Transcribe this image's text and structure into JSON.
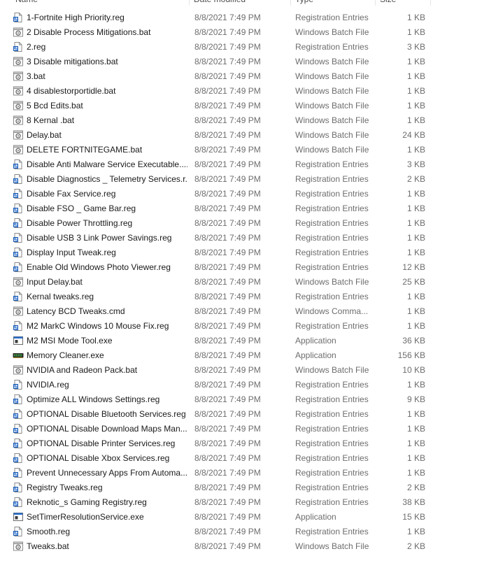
{
  "columns": {
    "name": "Name",
    "date_modified": "Date modified",
    "type": "Type",
    "size": "Size"
  },
  "files": [
    {
      "name": "1-Fortnite High Priority.reg",
      "date": "8/8/2021 7:49 PM",
      "type": "Registration Entries",
      "size": "1 KB",
      "icon": "reg-file-icon"
    },
    {
      "name": "2 Disable Process Mitigations.bat",
      "date": "8/8/2021 7:49 PM",
      "type": "Windows Batch File",
      "size": "1 KB",
      "icon": "bat-file-icon"
    },
    {
      "name": "2.reg",
      "date": "8/8/2021 7:49 PM",
      "type": "Registration Entries",
      "size": "3 KB",
      "icon": "reg-file-icon"
    },
    {
      "name": "3 Disable mitigations.bat",
      "date": "8/8/2021 7:49 PM",
      "type": "Windows Batch File",
      "size": "1 KB",
      "icon": "bat-file-icon"
    },
    {
      "name": "3.bat",
      "date": "8/8/2021 7:49 PM",
      "type": "Windows Batch File",
      "size": "1 KB",
      "icon": "bat-file-icon"
    },
    {
      "name": "4 disablestorportidle.bat",
      "date": "8/8/2021 7:49 PM",
      "type": "Windows Batch File",
      "size": "1 KB",
      "icon": "bat-file-icon"
    },
    {
      "name": "5 Bcd Edits.bat",
      "date": "8/8/2021 7:49 PM",
      "type": "Windows Batch File",
      "size": "1 KB",
      "icon": "bat-file-icon"
    },
    {
      "name": "8 Kernal .bat",
      "date": "8/8/2021 7:49 PM",
      "type": "Windows Batch File",
      "size": "1 KB",
      "icon": "bat-file-icon"
    },
    {
      "name": "Delay.bat",
      "date": "8/8/2021 7:49 PM",
      "type": "Windows Batch File",
      "size": "24 KB",
      "icon": "bat-file-icon"
    },
    {
      "name": "DELETE FORTNITEGAME.bat",
      "date": "8/8/2021 7:49 PM",
      "type": "Windows Batch File",
      "size": "1 KB",
      "icon": "bat-file-icon"
    },
    {
      "name": "Disable Anti Malware Service Executable....",
      "date": "8/8/2021 7:49 PM",
      "type": "Registration Entries",
      "size": "3 KB",
      "icon": "reg-file-icon"
    },
    {
      "name": "Disable Diagnostics _ Telemetry Services.r...",
      "date": "8/8/2021 7:49 PM",
      "type": "Registration Entries",
      "size": "2 KB",
      "icon": "reg-file-icon"
    },
    {
      "name": "Disable Fax Service.reg",
      "date": "8/8/2021 7:49 PM",
      "type": "Registration Entries",
      "size": "1 KB",
      "icon": "reg-file-icon"
    },
    {
      "name": "Disable FSO _ Game Bar.reg",
      "date": "8/8/2021 7:49 PM",
      "type": "Registration Entries",
      "size": "1 KB",
      "icon": "reg-file-icon"
    },
    {
      "name": "Disable Power Throttling.reg",
      "date": "8/8/2021 7:49 PM",
      "type": "Registration Entries",
      "size": "1 KB",
      "icon": "reg-file-icon"
    },
    {
      "name": "Disable USB 3 Link Power Savings.reg",
      "date": "8/8/2021 7:49 PM",
      "type": "Registration Entries",
      "size": "1 KB",
      "icon": "reg-file-icon"
    },
    {
      "name": "Display Input Tweak.reg",
      "date": "8/8/2021 7:49 PM",
      "type": "Registration Entries",
      "size": "1 KB",
      "icon": "reg-file-icon"
    },
    {
      "name": "Enable Old Windows Photo Viewer.reg",
      "date": "8/8/2021 7:49 PM",
      "type": "Registration Entries",
      "size": "12 KB",
      "icon": "reg-file-icon"
    },
    {
      "name": "Input Delay.bat",
      "date": "8/8/2021 7:49 PM",
      "type": "Windows Batch File",
      "size": "25 KB",
      "icon": "bat-file-icon"
    },
    {
      "name": "Kernal tweaks.reg",
      "date": "8/8/2021 7:49 PM",
      "type": "Registration Entries",
      "size": "1 KB",
      "icon": "reg-file-icon"
    },
    {
      "name": "Latency BCD Tweaks.cmd",
      "date": "8/8/2021 7:49 PM",
      "type": "Windows Comma...",
      "size": "1 KB",
      "icon": "bat-file-icon"
    },
    {
      "name": "M2 MarkC Windows 10 Mouse Fix.reg",
      "date": "8/8/2021 7:49 PM",
      "type": "Registration Entries",
      "size": "1 KB",
      "icon": "reg-file-icon"
    },
    {
      "name": "M2 MSI Mode Tool.exe",
      "date": "8/8/2021 7:49 PM",
      "type": "Application",
      "size": "36 KB",
      "icon": "exe-file-icon"
    },
    {
      "name": "Memory Cleaner.exe",
      "date": "8/8/2021 7:49 PM",
      "type": "Application",
      "size": "156 KB",
      "icon": "memory-app-icon"
    },
    {
      "name": "NVIDIA and Radeon Pack.bat",
      "date": "8/8/2021 7:49 PM",
      "type": "Windows Batch File",
      "size": "10 KB",
      "icon": "bat-file-icon"
    },
    {
      "name": "NVIDIA.reg",
      "date": "8/8/2021 7:49 PM",
      "type": "Registration Entries",
      "size": "1 KB",
      "icon": "reg-file-icon"
    },
    {
      "name": "Optimize ALL Windows Settings.reg",
      "date": "8/8/2021 7:49 PM",
      "type": "Registration Entries",
      "size": "9 KB",
      "icon": "reg-file-icon"
    },
    {
      "name": "OPTIONAL Disable Bluetooth Services.reg",
      "date": "8/8/2021 7:49 PM",
      "type": "Registration Entries",
      "size": "1 KB",
      "icon": "reg-file-icon"
    },
    {
      "name": "OPTIONAL Disable Download Maps Man...",
      "date": "8/8/2021 7:49 PM",
      "type": "Registration Entries",
      "size": "1 KB",
      "icon": "reg-file-icon"
    },
    {
      "name": "OPTIONAL Disable Printer Services.reg",
      "date": "8/8/2021 7:49 PM",
      "type": "Registration Entries",
      "size": "1 KB",
      "icon": "reg-file-icon"
    },
    {
      "name": "OPTIONAL Disable Xbox Services.reg",
      "date": "8/8/2021 7:49 PM",
      "type": "Registration Entries",
      "size": "1 KB",
      "icon": "reg-file-icon"
    },
    {
      "name": "Prevent Unnecessary Apps From Automa...",
      "date": "8/8/2021 7:49 PM",
      "type": "Registration Entries",
      "size": "1 KB",
      "icon": "reg-file-icon"
    },
    {
      "name": "Registry Tweaks.reg",
      "date": "8/8/2021 7:49 PM",
      "type": "Registration Entries",
      "size": "2 KB",
      "icon": "reg-file-icon"
    },
    {
      "name": "Reknotic_s Gaming Registry.reg",
      "date": "8/8/2021 7:49 PM",
      "type": "Registration Entries",
      "size": "38 KB",
      "icon": "reg-file-icon"
    },
    {
      "name": "SetTimerResolutionService.exe",
      "date": "8/8/2021 7:49 PM",
      "type": "Application",
      "size": "15 KB",
      "icon": "exe-file-icon"
    },
    {
      "name": "Smooth.reg",
      "date": "8/8/2021 7:49 PM",
      "type": "Registration Entries",
      "size": "1 KB",
      "icon": "reg-file-icon"
    },
    {
      "name": "Tweaks.bat",
      "date": "8/8/2021 7:49 PM",
      "type": "Windows Batch File",
      "size": "2 KB",
      "icon": "bat-file-icon"
    }
  ],
  "colors": {
    "reg_icon_blue": "#1f5fb4",
    "bat_icon_gray": "#6e6e6e",
    "exe_icon_blue": "#2a6fc9",
    "memory_icon_green": "#3a8a3a",
    "secondary_text": "#6d6d6d"
  }
}
